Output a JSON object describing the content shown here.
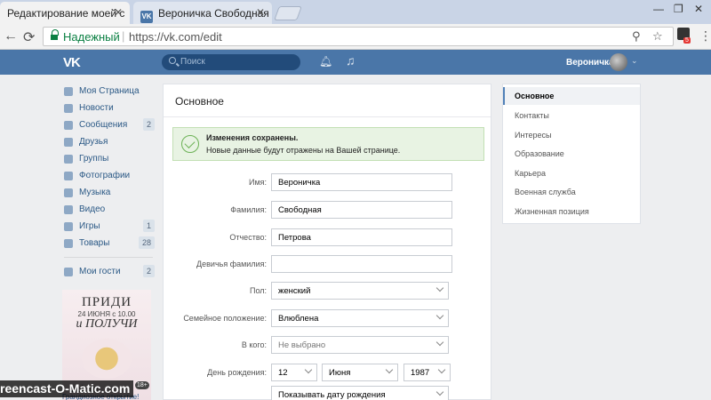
{
  "browser": {
    "tabs": [
      {
        "title": "Редактирование моей с"
      },
      {
        "title": "Вероничка Свободная",
        "favicon": "vk"
      }
    ],
    "secure_label": "Надежный",
    "url": "https://vk.com/edit",
    "extension_badge": "5"
  },
  "vk": {
    "logo": "VK",
    "search_placeholder": "Поиск",
    "username": "Вероничка"
  },
  "left_menu": [
    {
      "label": "Моя Страница",
      "icon": "home-icon"
    },
    {
      "label": "Новости",
      "icon": "news-icon"
    },
    {
      "label": "Сообщения",
      "icon": "messages-icon",
      "count": "2"
    },
    {
      "label": "Друзья",
      "icon": "friends-icon"
    },
    {
      "label": "Группы",
      "icon": "groups-icon"
    },
    {
      "label": "Фотографии",
      "icon": "photos-icon"
    },
    {
      "label": "Музыка",
      "icon": "music-icon"
    },
    {
      "label": "Видео",
      "icon": "video-icon"
    },
    {
      "label": "Игры",
      "icon": "games-icon",
      "count": "1"
    },
    {
      "label": "Товары",
      "icon": "goods-icon",
      "count": "28"
    },
    {
      "label": "Мои гости",
      "icon": "guests-icon",
      "count": "2"
    }
  ],
  "ad": {
    "title": "ПРИДИ",
    "date": "24 ИЮНЯ с 10.00",
    "subtitle": "и ПОЛУЧИ",
    "brand": "zoloto",
    "age": "18+",
    "caption": "Грандиозное открытие!"
  },
  "recording_watermark": "reencast-O-Matic.com",
  "main": {
    "title": "Основное",
    "success_title": "Изменения сохранены.",
    "success_text": "Новые данные будут отражены на Вашей странице.",
    "fields": {
      "first_name": {
        "label": "Имя:",
        "value": "Вероничка"
      },
      "last_name": {
        "label": "Фамилия:",
        "value": "Свободная"
      },
      "patronymic": {
        "label": "Отчество:",
        "value": "Петрова"
      },
      "maiden_name": {
        "label": "Девичья фамилия:",
        "value": ""
      },
      "sex": {
        "label": "Пол:",
        "value": "женский"
      },
      "relationship": {
        "label": "Семейное положение:",
        "value": "Влюблена"
      },
      "partner": {
        "label": "В кого:",
        "value": "Не выбрано"
      },
      "birthday": {
        "label": "День рождения:",
        "day": "12",
        "month": "Июня",
        "year": "1987",
        "visibility": "Показывать дату рождения"
      }
    }
  },
  "right_menu": [
    {
      "label": "Основное",
      "active": true
    },
    {
      "label": "Контакты"
    },
    {
      "label": "Интересы"
    },
    {
      "label": "Образование"
    },
    {
      "label": "Карьера"
    },
    {
      "label": "Военная служба"
    },
    {
      "label": "Жизненная позиция"
    }
  ],
  "colors": {
    "vk_header": "#4a76a8",
    "link": "#2a5885",
    "page_bg": "#edeef0",
    "success_bg": "#e8f3e3",
    "secure_green": "#0b8043"
  }
}
